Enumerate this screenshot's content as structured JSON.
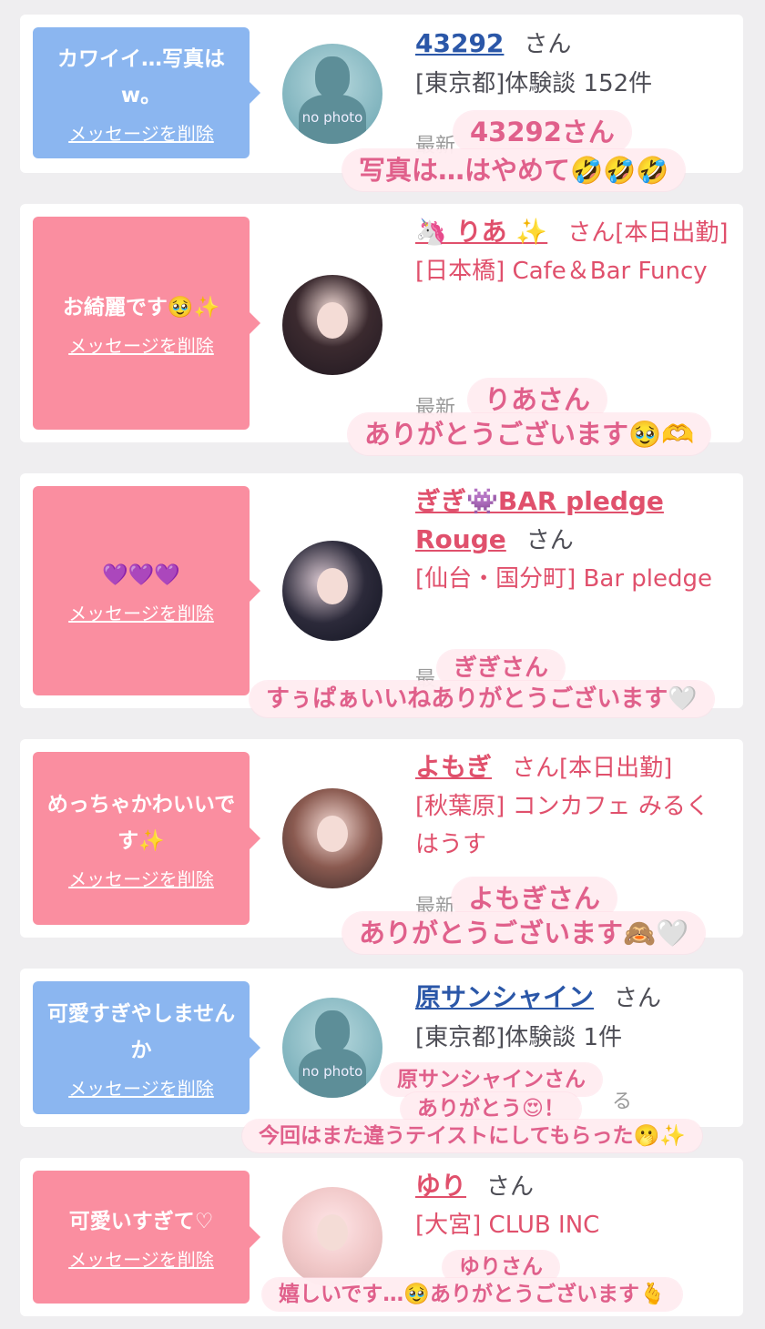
{
  "items": [
    {
      "message": "カワイイ…写真はw。",
      "delete_label": "メッセージを削除",
      "bubble_color": "#8bb6f0",
      "avatar": "no photo",
      "name": "43292",
      "san": "さん",
      "details": [
        "[東京都]体験談 152件"
      ],
      "truncated": "最新",
      "stamp_lines": [
        "43292さん",
        "写真は…はやめて🤣🤣🤣"
      ]
    },
    {
      "message": "お綺麗です🥹✨",
      "delete_label": "メッセージを削除",
      "bubble_color": "#fa8ea0",
      "name": "🦄 りあ ✨",
      "san": "さん[本日出勤]",
      "details": [
        "[日本橋] Cafe＆Bar Funcy"
      ],
      "truncated": "最新",
      "stamp_lines": [
        "りあさん",
        "ありがとうございます🥹🫶"
      ]
    },
    {
      "message": "💜💜💜",
      "delete_label": "メッセージを削除",
      "bubble_color": "#fa8ea0",
      "name": "ぎぎ👾BAR pledge Rouge",
      "san": "さん",
      "details": [
        "[仙台・国分町] Bar pledge"
      ],
      "truncated": "最",
      "stamp_lines": [
        "ぎぎさん",
        "すぅぱぁいいねありがとうございます🤍"
      ]
    },
    {
      "message": "めっちゃかわいいです✨",
      "delete_label": "メッセージを削除",
      "bubble_color": "#fa8ea0",
      "name": "よもぎ",
      "san": "さん[本日出勤]",
      "details": [
        "[秋葉原] コンカフェ みるくはうす"
      ],
      "truncated": "最新",
      "stamp_lines": [
        "よもぎさん",
        "ありがとうございます🙈🤍"
      ]
    },
    {
      "message": "可愛すぎやしませんか",
      "delete_label": "メッセージを削除",
      "bubble_color": "#8bb6f0",
      "avatar": "no photo",
      "name": "原サンシャイン",
      "san": "さん",
      "details": [
        "[東京都]体験談 1件"
      ],
      "truncated": "る",
      "stamp_lines": [
        "原サンシャインさん",
        "ありがとう😍！",
        "今回はまた違うテイストにしてもらった🫢✨"
      ]
    },
    {
      "message": "可愛いすぎて♡",
      "delete_label": "メッセージを削除",
      "bubble_color": "#fa8ea0",
      "name": "ゆり",
      "san": "さん",
      "details": [
        "[大宮] CLUB INC"
      ],
      "stamp_lines": [
        "ゆりさん",
        "嬉しいです…🥹ありがとうございます🫰"
      ]
    }
  ]
}
